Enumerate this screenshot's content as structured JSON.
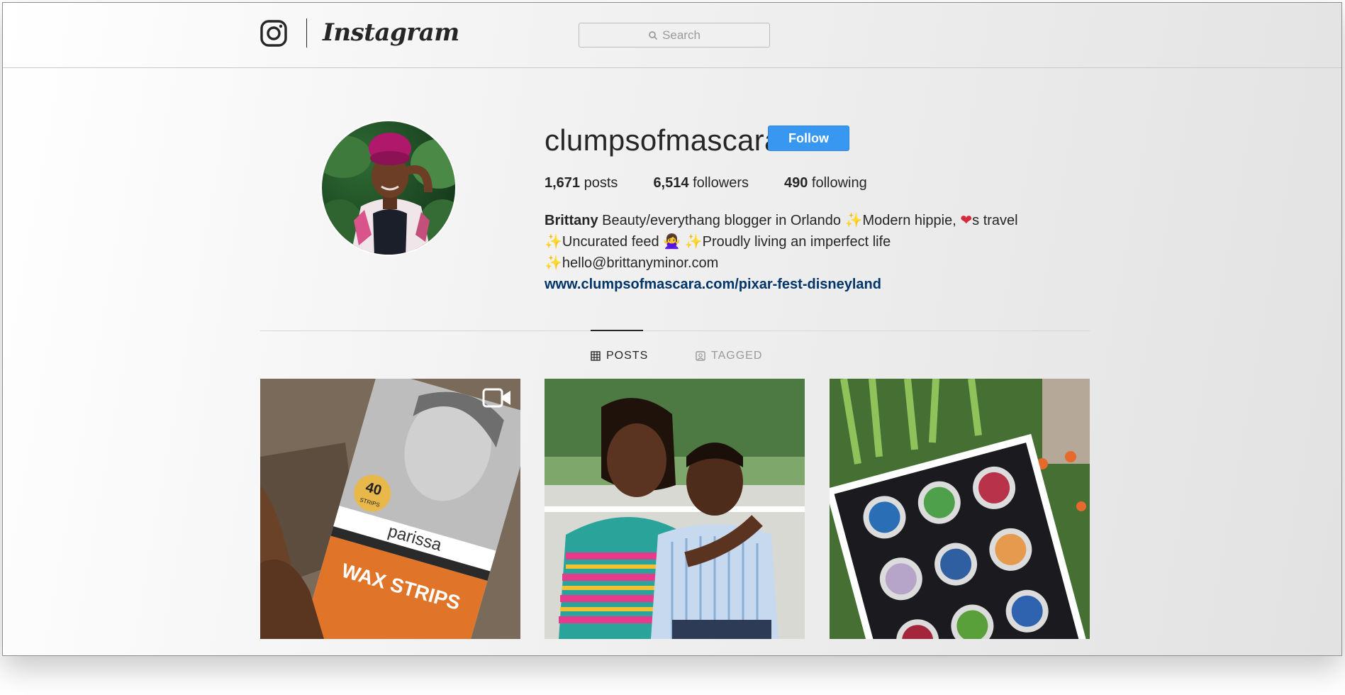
{
  "header": {
    "brand": "Instagram",
    "search_placeholder": "Search"
  },
  "profile": {
    "username": "clumpsofmascara",
    "follow_label": "Follow",
    "stats": [
      {
        "count": "1,671",
        "label": "posts"
      },
      {
        "count": "6,514",
        "label": "followers"
      },
      {
        "count": "490",
        "label": "following"
      }
    ],
    "full_name": "Brittany",
    "bio": {
      "line1": "Beauty/everythang blogger in Orlando",
      "line1b": "Modern hippie,",
      "line1c": "s travel",
      "line2a": "Uncurated feed",
      "line2b": "Proudly living an imperfect life",
      "line3": "hello@brittanyminor.com"
    },
    "website": "www.clumpsofmascara.com/pixar-fest-disneyland"
  },
  "tabs": [
    {
      "label": "POSTS",
      "active": true
    },
    {
      "label": "TAGGED",
      "active": false
    }
  ],
  "posts": [
    {
      "description_icon": "video-icon",
      "label_text_1": "40",
      "label_text_2": "STRIPS",
      "label_text_3": "parissa",
      "label_text_4": "WAX STRIPS"
    },
    {},
    {}
  ],
  "colors": {
    "accent": "#3897f0",
    "link": "#003569",
    "text": "#262626",
    "muted": "#999999"
  }
}
